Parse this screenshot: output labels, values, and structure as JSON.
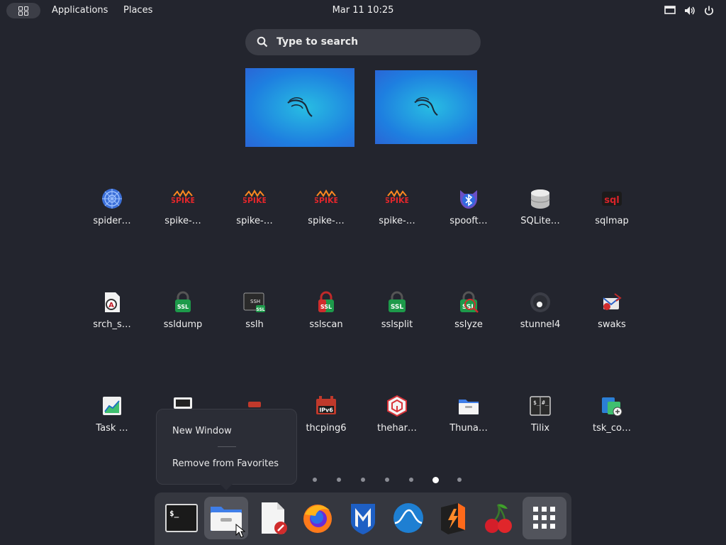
{
  "topbar": {
    "applications_label": "Applications",
    "places_label": "Places",
    "clock": "Mar 11  10:25",
    "tray_icons": [
      "display-icon",
      "volume-icon",
      "power-icon"
    ]
  },
  "search": {
    "placeholder": "Type to search"
  },
  "workspaces": [
    "workspace-1",
    "workspace-2"
  ],
  "apps": [
    {
      "label": "spider…",
      "icon": "spider-icon"
    },
    {
      "label": "spike-…",
      "icon": "spike-icon"
    },
    {
      "label": "spike-…",
      "icon": "spike-icon"
    },
    {
      "label": "spike-…",
      "icon": "spike-icon"
    },
    {
      "label": "spike-…",
      "icon": "spike-icon"
    },
    {
      "label": "spooft…",
      "icon": "bluetooth-icon"
    },
    {
      "label": "SQLite…",
      "icon": "database-icon"
    },
    {
      "label": "sqlmap",
      "icon": "sqlmap-icon"
    },
    {
      "label": "srch_s…",
      "icon": "document-search-icon"
    },
    {
      "label": "ssldump",
      "icon": "ssl-lock-icon"
    },
    {
      "label": "sslh",
      "icon": "ssh-terminal-icon"
    },
    {
      "label": "sslscan",
      "icon": "ssl-lock-icon"
    },
    {
      "label": "sslsplit",
      "icon": "ssl-lock-icon"
    },
    {
      "label": "sslyze",
      "icon": "ssl-lock-icon"
    },
    {
      "label": "stunnel4",
      "icon": "stunnel-icon"
    },
    {
      "label": "swaks",
      "icon": "swaks-icon"
    },
    {
      "label": "Task …",
      "icon": "task-manager-icon"
    },
    {
      "label": "",
      "icon": "terminal-app-icon"
    },
    {
      "label": "",
      "icon": "app-icon"
    },
    {
      "label": "thcping6",
      "icon": "ipv6-icon"
    },
    {
      "label": "thehar…",
      "icon": "theharvester-icon"
    },
    {
      "label": "Thuna…",
      "icon": "folder-icon"
    },
    {
      "label": "Tilix",
      "icon": "terminal-icon"
    },
    {
      "label": "tsk_co…",
      "icon": "tsk-icon"
    }
  ],
  "pages": {
    "count": 7,
    "active_index": 5
  },
  "context_menu": {
    "items": [
      "New Window",
      "Remove from Favorites"
    ]
  },
  "dock": [
    {
      "name": "terminal",
      "icon": "terminal-icon",
      "running": false
    },
    {
      "name": "files",
      "icon": "folder-icon",
      "running": true
    },
    {
      "name": "text-editor",
      "icon": "text-editor-icon",
      "running": false
    },
    {
      "name": "firefox",
      "icon": "firefox-icon",
      "running": false
    },
    {
      "name": "metasploit",
      "icon": "metasploit-icon",
      "running": false
    },
    {
      "name": "wireshark",
      "icon": "wireshark-icon",
      "running": false
    },
    {
      "name": "burpsuite",
      "icon": "burp-icon",
      "running": false
    },
    {
      "name": "cherrytree",
      "icon": "cherry-icon",
      "running": false
    },
    {
      "name": "show-apps",
      "icon": "app-grid-icon",
      "running": true
    }
  ]
}
